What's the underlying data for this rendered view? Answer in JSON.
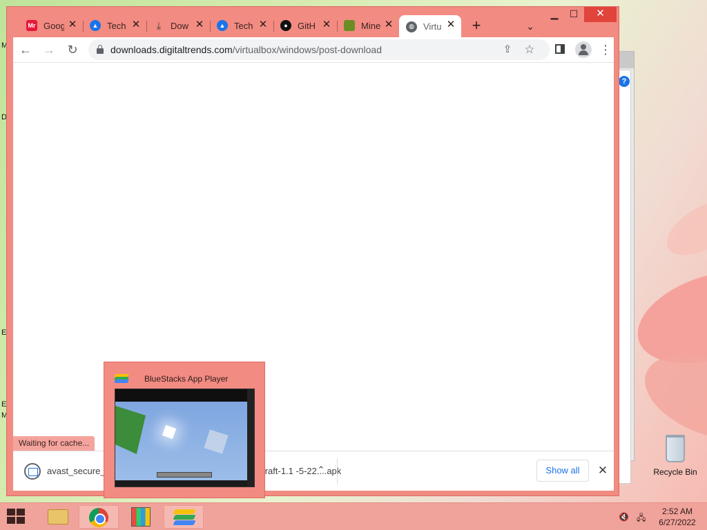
{
  "browser": {
    "tabs": [
      {
        "title": "Goog",
        "icon": "mr-icon",
        "color": "#e8173a"
      },
      {
        "title": "Tech",
        "icon": "techspot-icon",
        "color": "#1a73e8"
      },
      {
        "title": "Dow",
        "icon": "download-icon",
        "color": "#8a5a55"
      },
      {
        "title": "Tech",
        "icon": "techspot-icon",
        "color": "#1a73e8"
      },
      {
        "title": "GitH",
        "icon": "github-icon",
        "color": "#111111"
      },
      {
        "title": "Mine",
        "icon": "minecraft-icon",
        "color": "#6b8e23"
      },
      {
        "title": "Virtu",
        "icon": "globe-icon",
        "color": "#5f6368",
        "active": true
      }
    ],
    "address": {
      "domain": "downloads.digitaltrends.com",
      "path": "/virtualbox/windows/post-download"
    },
    "status_text": "Waiting for cache...",
    "download": {
      "filename_left": "avast_secure_b",
      "filename_mid": "se",
      "filename_right": "eraft-1.1 -5-22....apk",
      "show_all": "Show all"
    }
  },
  "thumbnail": {
    "title": "BlueStacks App Player"
  },
  "desktop": {
    "recycle_bin_label": "Recycle Bin",
    "edge_letters": [
      "M",
      "D",
      "E",
      "E",
      "M"
    ]
  },
  "taskbar": {
    "time": "2:52 AM",
    "date": "6/27/2022",
    "apps": [
      "file-explorer",
      "chrome",
      "windows-media",
      "bluestacks"
    ]
  },
  "colors": {
    "accent": "#f28b82",
    "close_button": "#e0443a",
    "link_blue": "#1a73e8"
  }
}
